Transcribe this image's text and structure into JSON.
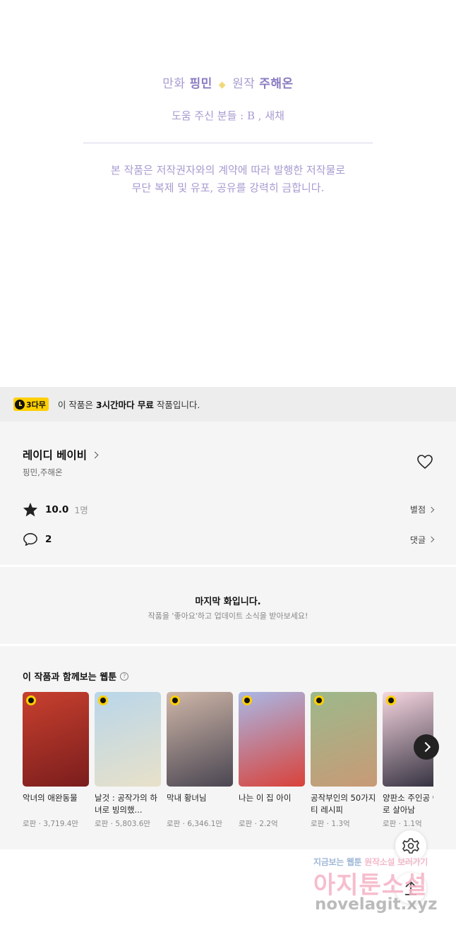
{
  "credits": {
    "label_manhwa": "만화",
    "artist": "핑민",
    "diamond": "◆",
    "label_original": "원작",
    "author": "주해온",
    "assistants": "도움 주신 분들 : B , 새채",
    "copyright_line1": "본 작품은 저작권자와의 계약에 따라 발행한 저작물로",
    "copyright_line2": "무단 복제 및 유포, 공유를 강력히 금합니다."
  },
  "notice": {
    "badge": "3다무",
    "text_prefix": "이 작품은 ",
    "text_bold": "3시간마다 무료",
    "text_suffix": " 작품입니다."
  },
  "work": {
    "title": "레이디 베이비",
    "authors": "핑민,주해온",
    "rating": "10.0",
    "rating_count": "1명",
    "rating_link": "별점",
    "comments": "2",
    "comments_link": "댓글"
  },
  "last_episode": {
    "title": "마지막 화입니다.",
    "subtitle": "작품을 '좋아요'하고 업데이트 소식을 받아보세요!"
  },
  "recommendations": {
    "title": "이 작품과 함께보는 웹툰",
    "help": "?",
    "items": [
      {
        "title": "악녀의 애완동물",
        "meta": "로판 · 3,719.4만",
        "bg": "#c8402e",
        "bg2": "#7a1d1d"
      },
      {
        "title": "날것 : 공작가의 하녀로 빙의했...",
        "meta": "로판 · 5,803.6만",
        "bg": "#b9d6ea",
        "bg2": "#e8e1c9"
      },
      {
        "title": "막내 황녀님",
        "meta": "로판 · 6,346.1만",
        "bg": "#cfb6a8",
        "bg2": "#4a4652"
      },
      {
        "title": "나는 이 집 아이",
        "meta": "로판 · 2.2억",
        "bg": "#a9b8e6",
        "bg2": "#d9423a"
      },
      {
        "title": "공작부인의 50가지 티 레시피",
        "meta": "로판 · 1.3억",
        "bg": "#9cb98b",
        "bg2": "#c89a76"
      },
      {
        "title": "양판소 주인공 아내로 살아남",
        "meta": "로판 · 1.1억",
        "bg": "#f6d6e0",
        "bg2": "#2d2b3a"
      }
    ]
  },
  "watermark": {
    "tagline_a": "지금보는 웹툰 ",
    "tagline_b": "원작소설 보러가기",
    "brand": "아지툰소설",
    "url": "novelagit.xyz"
  },
  "colors": {
    "credit_text": "#a79bd0",
    "free_badge": "#ffcf00",
    "section_bg": "#f5f5f5"
  },
  "icons": {
    "clock": "clock-icon",
    "heart": "heart-icon",
    "star": "star-icon",
    "comment": "comment-bubble-icon",
    "gear": "gear-icon",
    "top": "arrow-up-icon",
    "next": "chevron-right-icon"
  }
}
